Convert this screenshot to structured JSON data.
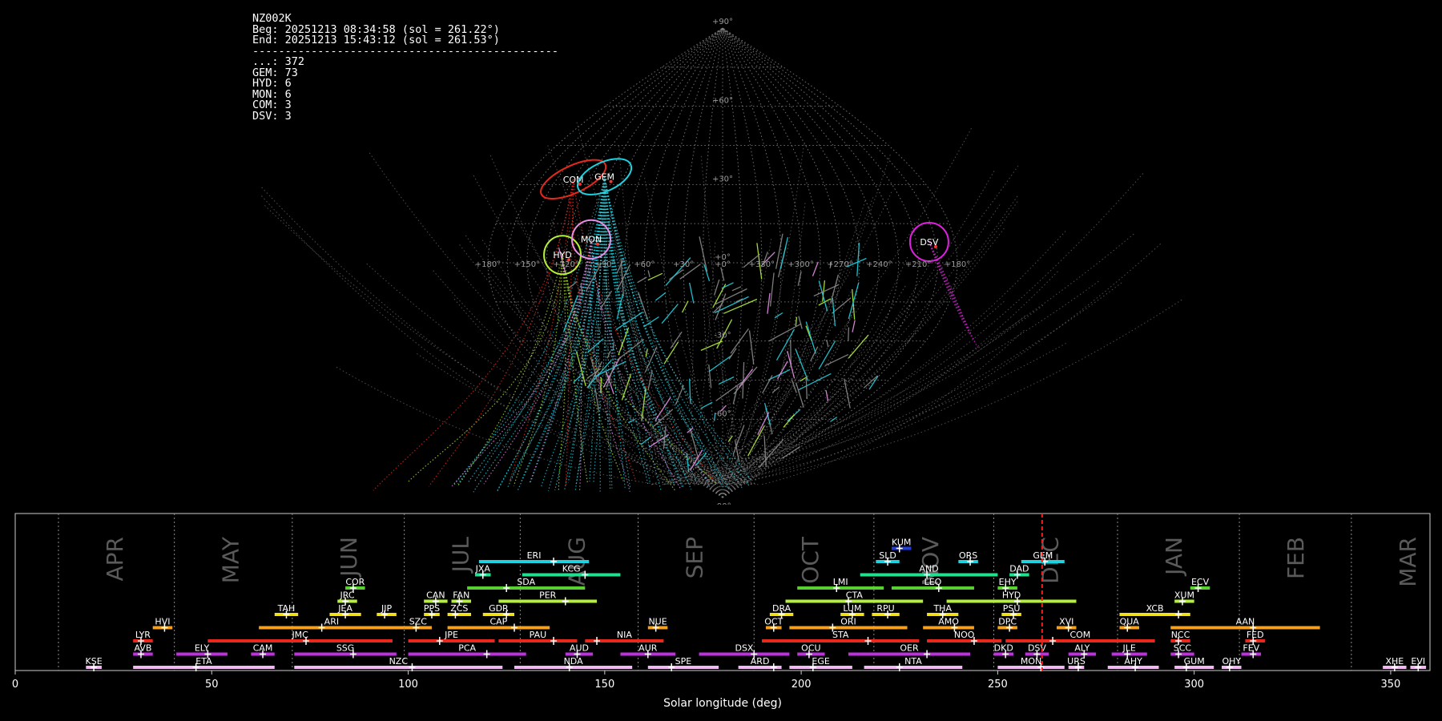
{
  "info": {
    "station": "NZ002K",
    "begin": "Beg: 20251213 08:34:58 (sol = 261.22°)",
    "end": "End: 20251213 15:43:12 (sol = 261.53°)",
    "separator": "-----------------------------------------------",
    "counts": [
      {
        "code": "...",
        "text": "...: 372"
      },
      {
        "code": "GEM",
        "text": "GEM: 73"
      },
      {
        "code": "HYD",
        "text": "HYD: 6"
      },
      {
        "code": "MON",
        "text": "MON: 6"
      },
      {
        "code": "COM",
        "text": "COM: 3"
      },
      {
        "code": "DSV",
        "text": "DSV: 3"
      }
    ]
  },
  "colors": {
    "sporadic": "#8a8a8a",
    "GEM": "#1fd2e0",
    "HYD": "#b4f03a",
    "MON": "#e890e8",
    "COM": "#e8281c",
    "DSV": "#e020e0",
    "grid": "#8a8a8a"
  },
  "sky_map": {
    "projection": "sinusoidal",
    "lat_labels": [
      "+90°",
      "+60°",
      "+30°",
      "+0°",
      "-30°",
      "-60°",
      "-90°"
    ],
    "lat_values": [
      90,
      60,
      30,
      0,
      -30,
      -60,
      -90
    ],
    "lon_labels": [
      "+180°",
      "+150°",
      "+120°",
      "+90°",
      "+60°",
      "+30°",
      "+0°",
      "+330°",
      "+300°",
      "+270°",
      "+240°",
      "+210°",
      "+180°"
    ],
    "lon_values": [
      180,
      150,
      120,
      90,
      60,
      30,
      0,
      -30,
      -60,
      -90,
      -120,
      -150,
      -180
    ],
    "radiants": [
      {
        "code": "COM",
        "label": "COM",
        "lon": 135,
        "lat": 32
      },
      {
        "code": "GEM",
        "label": "GEM",
        "lon": 108,
        "lat": 33
      },
      {
        "code": "HYD",
        "label": "HYD",
        "lon": 123,
        "lat": 3
      },
      {
        "code": "MON",
        "label": "MON",
        "lon": 102,
        "lat": 9
      },
      {
        "code": "DSV",
        "label": "DSV",
        "lon": -160,
        "lat": 8
      }
    ]
  },
  "chart_data": {
    "type": "timeline",
    "xlabel": "Solar longitude (deg)",
    "xlim": [
      0,
      360
    ],
    "x_ticks": [
      0,
      50,
      100,
      150,
      200,
      250,
      300,
      350
    ],
    "current_sol": 261.3,
    "months": [
      {
        "label": "APR",
        "start": 11
      },
      {
        "label": "MAY",
        "start": 40.5
      },
      {
        "label": "JUN",
        "start": 70.5
      },
      {
        "label": "JUL",
        "start": 99
      },
      {
        "label": "AUG",
        "start": 128.5
      },
      {
        "label": "SEP",
        "start": 158.5
      },
      {
        "label": "OCT",
        "start": 188
      },
      {
        "label": "NOV",
        "start": 218.5
      },
      {
        "label": "DEC",
        "start": 249
      },
      {
        "label": "JAN",
        "start": 280.5
      },
      {
        "label": "FEB",
        "start": 311.5
      },
      {
        "label": "MAR",
        "start": 340
      }
    ],
    "showers": [
      {
        "code": "KSE",
        "start": 18,
        "end": 22,
        "peak": 20,
        "row": 0,
        "color": "#f1b8f1"
      },
      {
        "code": "ETA",
        "start": 30,
        "end": 66,
        "peak": 46,
        "row": 0,
        "color": "#f1b8f1"
      },
      {
        "code": "NZC",
        "start": 71,
        "end": 124,
        "peak": 101,
        "row": 0,
        "color": "#f1b8f1"
      },
      {
        "code": "NDA",
        "start": 127,
        "end": 157,
        "peak": 141,
        "row": 0,
        "color": "#f1b8f1"
      },
      {
        "code": "SPE",
        "start": 161,
        "end": 179,
        "peak": 167,
        "row": 0,
        "color": "#f1b8f1"
      },
      {
        "code": "ARD",
        "start": 184,
        "end": 195,
        "peak": 193,
        "row": 0,
        "color": "#f1b8f1"
      },
      {
        "code": "EGE",
        "start": 197,
        "end": 213,
        "peak": 203,
        "row": 0,
        "color": "#f1b8f1"
      },
      {
        "code": "NTA",
        "start": 216,
        "end": 241,
        "peak": 225,
        "row": 0,
        "color": "#f1b8f1"
      },
      {
        "code": "MON",
        "start": 250,
        "end": 267,
        "peak": 261,
        "row": 0,
        "color": "#f1b8f1"
      },
      {
        "code": "URS",
        "start": 268,
        "end": 272,
        "peak": 270.5,
        "row": 0,
        "color": "#f1b8f1"
      },
      {
        "code": "AHY",
        "start": 278,
        "end": 291,
        "peak": 285,
        "row": 0,
        "color": "#f1b8f1"
      },
      {
        "code": "GUM",
        "start": 295,
        "end": 305,
        "peak": 298,
        "row": 0,
        "color": "#f1b8f1"
      },
      {
        "code": "OHY",
        "start": 307,
        "end": 312,
        "peak": 309,
        "row": 0,
        "color": "#f1b8f1"
      },
      {
        "code": "XHE",
        "start": 348,
        "end": 354,
        "peak": 351,
        "row": 0,
        "color": "#f1b8f1"
      },
      {
        "code": "EVI",
        "start": 355,
        "end": 359,
        "peak": 357,
        "row": 0,
        "color": "#f1b8f1"
      },
      {
        "code": "AVB",
        "start": 30,
        "end": 35,
        "peak": 32,
        "row": 1,
        "color": "#c030e0"
      },
      {
        "code": "ELY",
        "start": 41,
        "end": 54,
        "peak": 49,
        "row": 1,
        "color": "#c030e0"
      },
      {
        "code": "CAM",
        "start": 60,
        "end": 66,
        "peak": 63,
        "row": 1,
        "color": "#c030e0"
      },
      {
        "code": "SSG",
        "start": 71,
        "end": 97,
        "peak": 86,
        "row": 1,
        "color": "#c030e0"
      },
      {
        "code": "PCA",
        "start": 100,
        "end": 130,
        "peak": 120,
        "row": 1,
        "color": "#c030e0"
      },
      {
        "code": "AUD",
        "start": 140,
        "end": 147,
        "peak": 143,
        "row": 1,
        "color": "#c030e0"
      },
      {
        "code": "AUR",
        "start": 154,
        "end": 168,
        "peak": 161,
        "row": 1,
        "color": "#c030e0"
      },
      {
        "code": "DSX",
        "start": 174,
        "end": 197,
        "peak": 188,
        "row": 1,
        "color": "#c030e0"
      },
      {
        "code": "OCU",
        "start": 199,
        "end": 206,
        "peak": 202,
        "row": 1,
        "color": "#c030e0"
      },
      {
        "code": "OER",
        "start": 212,
        "end": 243,
        "peak": 232,
        "row": 1,
        "color": "#c030e0"
      },
      {
        "code": "DKD",
        "start": 249,
        "end": 254,
        "peak": 252,
        "row": 1,
        "color": "#c030e0"
      },
      {
        "code": "DSV",
        "start": 257,
        "end": 263,
        "peak": 260,
        "row": 1,
        "color": "#c030e0"
      },
      {
        "code": "ALY",
        "start": 268,
        "end": 275,
        "peak": 272,
        "row": 1,
        "color": "#c030e0"
      },
      {
        "code": "JLE",
        "start": 279,
        "end": 288,
        "peak": 283,
        "row": 1,
        "color": "#c030e0"
      },
      {
        "code": "SCC",
        "start": 294,
        "end": 300,
        "peak": 296,
        "row": 1,
        "color": "#c030e0"
      },
      {
        "code": "FEV",
        "start": 312,
        "end": 317,
        "peak": 315,
        "row": 1,
        "color": "#c030e0"
      },
      {
        "code": "LYR",
        "start": 30,
        "end": 35,
        "peak": 32,
        "row": 2,
        "color": "#e8281c"
      },
      {
        "code": "JMC",
        "start": 49,
        "end": 96,
        "peak": 74,
        "row": 2,
        "color": "#e8281c"
      },
      {
        "code": "JPE",
        "start": 100,
        "end": 122,
        "peak": 108,
        "row": 2,
        "color": "#e8281c"
      },
      {
        "code": "PAU",
        "start": 123,
        "end": 143,
        "peak": 137,
        "row": 2,
        "color": "#e8281c"
      },
      {
        "code": "NIA",
        "start": 145,
        "end": 165,
        "peak": 148,
        "row": 2,
        "color": "#e8281c"
      },
      {
        "code": "STA",
        "start": 190,
        "end": 230,
        "peak": 217,
        "row": 2,
        "color": "#e8281c"
      },
      {
        "code": "NOO",
        "start": 232,
        "end": 251,
        "peak": 244,
        "row": 2,
        "color": "#e8281c"
      },
      {
        "code": "COM",
        "start": 252,
        "end": 290,
        "peak": 264,
        "row": 2,
        "color": "#e8281c"
      },
      {
        "code": "NCC",
        "start": 294,
        "end": 299,
        "peak": 296,
        "row": 2,
        "color": "#e8281c"
      },
      {
        "code": "FED",
        "start": 313,
        "end": 318,
        "peak": 315,
        "row": 2,
        "color": "#e8281c"
      },
      {
        "code": "HVI",
        "start": 35,
        "end": 40,
        "peak": 38,
        "row": 3,
        "color": "#f5a020"
      },
      {
        "code": "ARI",
        "start": 62,
        "end": 99,
        "peak": 78,
        "row": 3,
        "color": "#f5a020"
      },
      {
        "code": "SZC",
        "start": 99,
        "end": 106,
        "peak": 102,
        "row": 3,
        "color": "#f5a020"
      },
      {
        "code": "CAP",
        "start": 110,
        "end": 136,
        "peak": 127,
        "row": 3,
        "color": "#f5a020"
      },
      {
        "code": "NUE",
        "start": 161,
        "end": 166,
        "peak": 163,
        "row": 3,
        "color": "#f5a020"
      },
      {
        "code": "OCT",
        "start": 191,
        "end": 195,
        "peak": 193,
        "row": 3,
        "color": "#f5a020"
      },
      {
        "code": "ORI",
        "start": 197,
        "end": 227,
        "peak": 208,
        "row": 3,
        "color": "#f5a020"
      },
      {
        "code": "AMO",
        "start": 231,
        "end": 244,
        "peak": 239,
        "row": 3,
        "color": "#f5a020"
      },
      {
        "code": "DPC",
        "start": 250,
        "end": 255,
        "peak": 253,
        "row": 3,
        "color": "#f5a020"
      },
      {
        "code": "XVI",
        "start": 265,
        "end": 270,
        "peak": 268,
        "row": 3,
        "color": "#f5a020"
      },
      {
        "code": "QUA",
        "start": 281,
        "end": 286,
        "peak": 283,
        "row": 3,
        "color": "#f5a020"
      },
      {
        "code": "AAN",
        "start": 294,
        "end": 332,
        "peak": 315,
        "row": 3,
        "color": "#f5a020"
      },
      {
        "code": "TAH",
        "start": 66,
        "end": 72,
        "peak": 69,
        "row": 4,
        "color": "#f0e020"
      },
      {
        "code": "JEA",
        "start": 80,
        "end": 88,
        "peak": 84,
        "row": 4,
        "color": "#f0e020"
      },
      {
        "code": "JIP",
        "start": 92,
        "end": 97,
        "peak": 94,
        "row": 4,
        "color": "#f0e020"
      },
      {
        "code": "PPS",
        "start": 104,
        "end": 108,
        "peak": 106,
        "row": 4,
        "color": "#f0e020"
      },
      {
        "code": "ZCS",
        "start": 110,
        "end": 116,
        "peak": 112,
        "row": 4,
        "color": "#f0e020"
      },
      {
        "code": "GDR",
        "start": 119,
        "end": 127,
        "peak": 125,
        "row": 4,
        "color": "#f0e020"
      },
      {
        "code": "DRA",
        "start": 192,
        "end": 198,
        "peak": 195,
        "row": 4,
        "color": "#f0e020"
      },
      {
        "code": "LUM",
        "start": 210,
        "end": 216,
        "peak": 213,
        "row": 4,
        "color": "#f0e020"
      },
      {
        "code": "RPU",
        "start": 218,
        "end": 225,
        "peak": 222,
        "row": 4,
        "color": "#f0e020"
      },
      {
        "code": "THA",
        "start": 232,
        "end": 240,
        "peak": 236,
        "row": 4,
        "color": "#f0e020"
      },
      {
        "code": "PSU",
        "start": 251,
        "end": 256,
        "peak": 254,
        "row": 4,
        "color": "#f0e020"
      },
      {
        "code": "XCB",
        "start": 281,
        "end": 299,
        "peak": 296,
        "row": 4,
        "color": "#f0e020"
      },
      {
        "code": "JRC",
        "start": 82,
        "end": 87,
        "peak": 84,
        "row": 5,
        "color": "#b4f03a"
      },
      {
        "code": "CAN",
        "start": 104,
        "end": 110,
        "peak": 107,
        "row": 5,
        "color": "#b4f03a"
      },
      {
        "code": "FAN",
        "start": 111,
        "end": 116,
        "peak": 113,
        "row": 5,
        "color": "#b4f03a"
      },
      {
        "code": "PER",
        "start": 123,
        "end": 148,
        "peak": 140,
        "row": 5,
        "color": "#b4f03a"
      },
      {
        "code": "CTA",
        "start": 196,
        "end": 231,
        "peak": 212,
        "row": 5,
        "color": "#b4f03a"
      },
      {
        "code": "HYD",
        "start": 237,
        "end": 270,
        "peak": 255,
        "row": 5,
        "color": "#b4f03a"
      },
      {
        "code": "XUM",
        "start": 295,
        "end": 300,
        "peak": 297,
        "row": 5,
        "color": "#b4f03a"
      },
      {
        "code": "COR",
        "start": 84,
        "end": 89,
        "peak": 86,
        "row": 6,
        "color": "#58d030"
      },
      {
        "code": "SDA",
        "start": 115,
        "end": 145,
        "peak": 125,
        "row": 6,
        "color": "#58d030"
      },
      {
        "code": "LMI",
        "start": 199,
        "end": 221,
        "peak": 209,
        "row": 6,
        "color": "#58d030"
      },
      {
        "code": "LEO",
        "start": 223,
        "end": 244,
        "peak": 235,
        "row": 6,
        "color": "#58d030"
      },
      {
        "code": "EHY",
        "start": 250,
        "end": 255,
        "peak": 252,
        "row": 6,
        "color": "#58d030"
      },
      {
        "code": "ECV",
        "start": 299,
        "end": 304,
        "peak": 301,
        "row": 6,
        "color": "#58d030"
      },
      {
        "code": "JXA",
        "start": 117,
        "end": 121,
        "peak": 119,
        "row": 7,
        "color": "#20e090"
      },
      {
        "code": "KCG",
        "start": 129,
        "end": 154,
        "peak": 145,
        "row": 7,
        "color": "#20e090"
      },
      {
        "code": "AND",
        "start": 215,
        "end": 250,
        "peak": 232,
        "row": 7,
        "color": "#20e090"
      },
      {
        "code": "DAD",
        "start": 253,
        "end": 258,
        "peak": 255,
        "row": 7,
        "color": "#20e090"
      },
      {
        "code": "ERI",
        "start": 118,
        "end": 146,
        "peak": 137,
        "row": 8,
        "color": "#1fd2e0"
      },
      {
        "code": "SLD",
        "start": 219,
        "end": 225,
        "peak": 222,
        "row": 8,
        "color": "#1fd2e0"
      },
      {
        "code": "ORS",
        "start": 240,
        "end": 245,
        "peak": 243,
        "row": 8,
        "color": "#1fd2e0"
      },
      {
        "code": "GEM",
        "start": 256,
        "end": 267,
        "peak": 262,
        "row": 8,
        "color": "#1fd2e0"
      },
      {
        "code": "KUM",
        "start": 223,
        "end": 228,
        "peak": 225,
        "row": 9,
        "color": "#1f3ee8"
      }
    ]
  }
}
